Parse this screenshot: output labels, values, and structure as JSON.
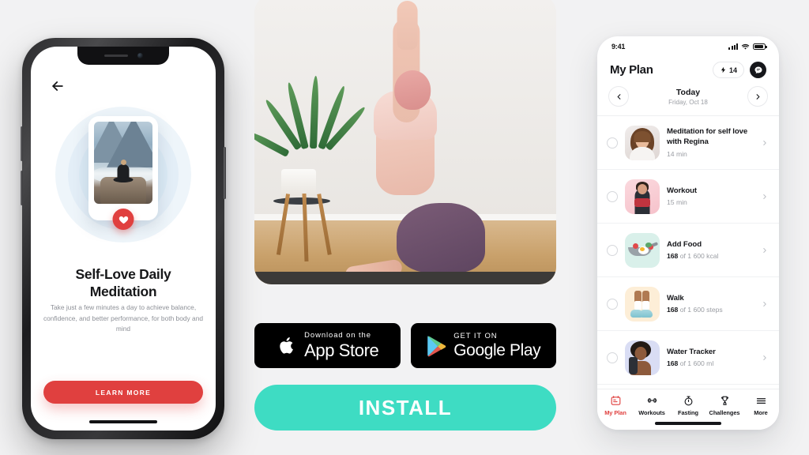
{
  "theme": {
    "page_bg": "#f2f2f3",
    "red_accent": "#e0403f",
    "teal_accent": "#3edcc3",
    "black": "#000000",
    "muted_text": "#9a9da3",
    "halo_blue": "#e3eef7"
  },
  "left_phone": {
    "back_icon": "back-arrow-icon",
    "card": {
      "image_alt": "meditation-on-mountain-rock",
      "heart_icon": "heart-icon"
    },
    "title": "Self-Love Daily Meditation",
    "subtitle": "Take just a few minutes a day to achieve balance, confidence, and better performance, for both body and mind",
    "cta_label": "LEARN MORE"
  },
  "center": {
    "hero_alt": "woman-doing-eagle-yoga-pose-with-aloe-plant",
    "store_badges": [
      {
        "id": "app-store-badge",
        "icon": "apple-logo-icon",
        "small_label": "Download on the",
        "big_label": "App Store"
      },
      {
        "id": "google-play-badge",
        "icon": "google-play-logo-icon",
        "small_label": "GET IT ON",
        "big_label": "Google Play"
      }
    ],
    "install_label": "INSTALL"
  },
  "right_phone": {
    "status_bar": {
      "time": "9:41",
      "icons": [
        "signal-bars-icon",
        "wifi-icon",
        "battery-icon"
      ]
    },
    "header": {
      "title": "My Plan",
      "streak": {
        "icon": "lightning-bolt-icon",
        "value": "14"
      },
      "chat": {
        "icon": "chat-bubble-icon"
      }
    },
    "date_nav": {
      "prev_icon": "chevron-left-icon",
      "next_icon": "chevron-right-icon",
      "label": "Today",
      "date": "Friday, Oct 18"
    },
    "plan_items": [
      {
        "thumb": "meditation-coach-portrait",
        "title": "Meditation for self love with Regina",
        "meta_value": "",
        "meta_rest": "14 min",
        "chevron": "chevron-right-icon"
      },
      {
        "thumb": "workout-woman-pink",
        "title": "Workout",
        "meta_value": "",
        "meta_rest": "15 min",
        "chevron": "chevron-right-icon"
      },
      {
        "thumb": "food-pan-illustration",
        "title": "Add Food",
        "meta_value": "168",
        "meta_rest": " of 1 600 kcal",
        "chevron": "chevron-right-icon"
      },
      {
        "thumb": "walking-sneakers-illustration",
        "title": "Walk",
        "meta_value": "168",
        "meta_rest": " of 1 600 steps",
        "chevron": "chevron-right-icon"
      },
      {
        "thumb": "water-bottle-woman",
        "title": "Water Tracker",
        "meta_value": "168",
        "meta_rest": " of 1 600 ml",
        "chevron": "chevron-right-icon"
      }
    ],
    "tabs": [
      {
        "label": "My Plan",
        "icon": "my-plan-icon",
        "active": true
      },
      {
        "label": "Workouts",
        "icon": "dumbbell-icon",
        "active": false
      },
      {
        "label": "Fasting",
        "icon": "timer-icon",
        "active": false
      },
      {
        "label": "Challenges",
        "icon": "trophy-icon",
        "active": false
      },
      {
        "label": "More",
        "icon": "hamburger-icon",
        "active": false
      }
    ]
  }
}
